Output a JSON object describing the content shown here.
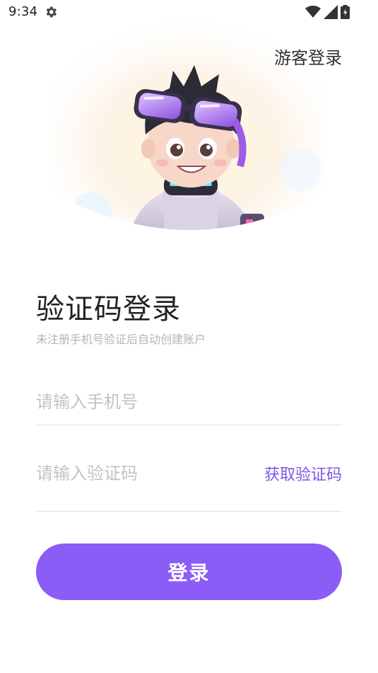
{
  "status_bar": {
    "time": "9:34",
    "icons": [
      "settings-gear-icon",
      "wifi-icon",
      "signal-icon",
      "battery-icon"
    ]
  },
  "header": {
    "guest_login": "游客登录"
  },
  "hero": {
    "image": "cartoon-boy-with-goggles-illustration"
  },
  "form": {
    "title": "验证码登录",
    "subtitle": "未注册手机号验证后自动创建账户",
    "phone_placeholder": "请输入手机号",
    "phone_value": "",
    "code_placeholder": "请输入验证码",
    "code_value": "",
    "get_code_label": "获取验证码",
    "submit_label": "登录"
  },
  "colors": {
    "accent": "#8b5cf6",
    "link": "#7e55e8",
    "placeholder": "#c3c3c3",
    "subtitle": "#b5b5b5",
    "divider": "#e2e2e2"
  }
}
